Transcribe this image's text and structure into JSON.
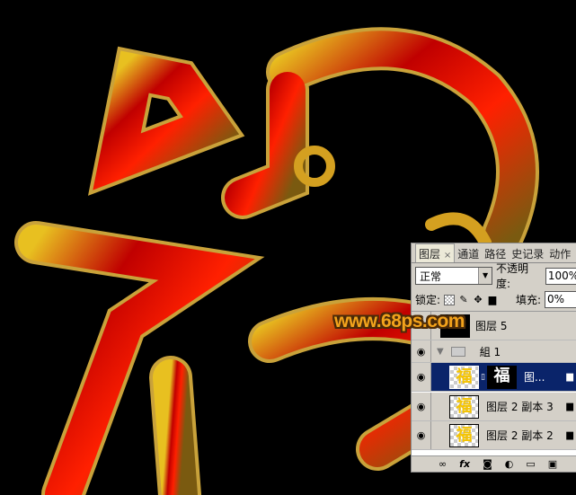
{
  "watermark": "www.68ps.com",
  "panel": {
    "tabs": [
      {
        "label": "图层",
        "active": true
      },
      {
        "label": "通道"
      },
      {
        "label": "路径"
      },
      {
        "label": "史记录"
      },
      {
        "label": "动作"
      }
    ],
    "close_glyph": "×",
    "blend_mode": "正常",
    "opacity_label": "不透明度:",
    "opacity_value": "100%",
    "lock_label": "锁定:",
    "fill_label": "填充:",
    "fill_value": "0%",
    "layers": [
      {
        "name": "图层 5",
        "visible": false
      },
      {
        "name": "組 1",
        "visible": true,
        "type": "group",
        "expanded": true
      },
      {
        "name": "图...",
        "visible": true,
        "selected": true,
        "has_mask": true,
        "locked": true
      },
      {
        "name": "图层 2 副本 3",
        "visible": true,
        "locked": true
      },
      {
        "name": "图层 2 副本 2",
        "visible": true,
        "locked": true
      }
    ],
    "bottom_icons": [
      "link-icon",
      "fx-icon",
      "mask-icon",
      "adjustment-icon",
      "folder-icon",
      "new-layer-icon"
    ],
    "fx_label": "fx"
  },
  "colors": {
    "selected": "#0a246a",
    "panel": "#d4d0c8",
    "gold": "#e8c020",
    "red": "#d00000"
  }
}
